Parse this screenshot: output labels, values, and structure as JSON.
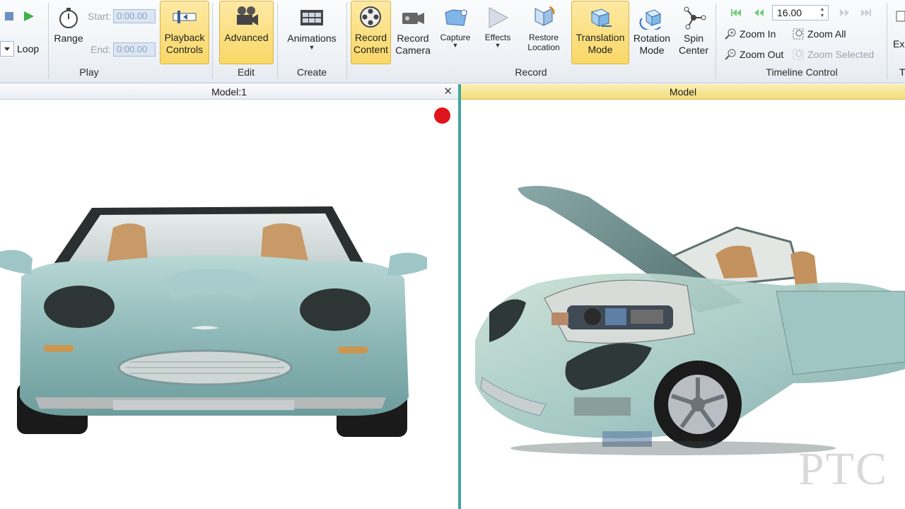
{
  "ribbon": {
    "play": {
      "loop_label": "Loop",
      "range_label": "Range",
      "start_label": "Start:",
      "end_label": "End:",
      "start_value": "0:00.00",
      "end_value": "0:00.00",
      "group_label": "Play"
    },
    "edit": {
      "playback_controls_label": "Playback Controls",
      "advanced_label": "Advanced",
      "group_label": "Edit"
    },
    "create": {
      "animations_label": "Animations",
      "group_label": "Create"
    },
    "record": {
      "record_content_label": "Record Content",
      "record_camera_label": "Record Camera",
      "capture_label": "Capture",
      "effects_label": "Effects",
      "restore_location_label": "Restore Location",
      "translation_mode_label": "Translation Mode",
      "rotation_mode_label": "Rotation Mode",
      "spin_center_label": "Spin Center",
      "group_label": "Record"
    },
    "timeline": {
      "value": "16.00",
      "zoom_in_label": "Zoom In",
      "zoom_all_label": "Zoom All",
      "zoom_out_label": "Zoom Out",
      "zoom_selected_label": "Zoom Selected",
      "group_label": "Timeline Control"
    },
    "overflow": {
      "top_label": "Ex",
      "bottom_label": "T"
    }
  },
  "panes": {
    "left_title": "Model:1",
    "right_title": "Model",
    "close_label": "✕"
  },
  "watermark": "PTC",
  "colors": {
    "active_button": "#f9d867",
    "record_dot": "#e0141c",
    "divider": "#3fa79f",
    "car_body": "#9fc6c6"
  }
}
